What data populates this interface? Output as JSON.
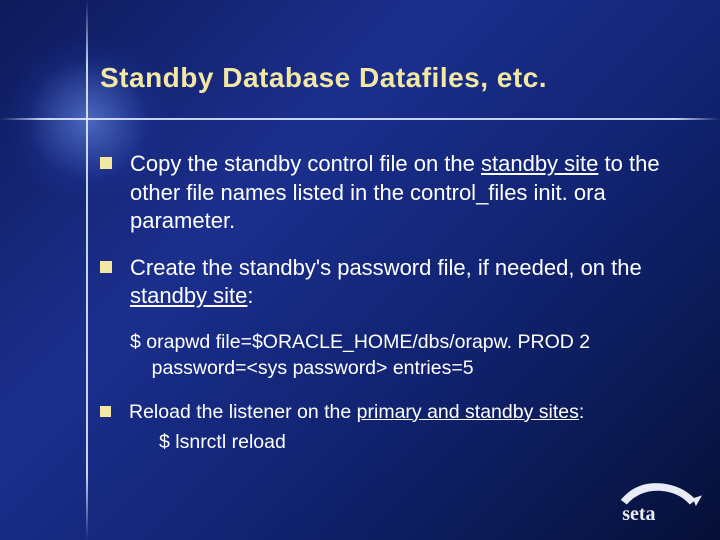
{
  "title": "Standby Database Datafiles, etc.",
  "bullets": {
    "b1": {
      "t1": "Copy the standby control file on the ",
      "u1": "standby site",
      "t2": " to the other file names listed in the control_files init. ora parameter."
    },
    "b2": {
      "t1": "Create the standby's password file, if needed, on the ",
      "u1": "standby site",
      "t2": ":"
    },
    "sub_cmd": {
      "l1": "$ orapwd file=$ORACLE_HOME/dbs/orapw. PROD 2",
      "l2": "password=<sys password> entries=5"
    },
    "b3": {
      "t1": "Reload the listener on the ",
      "u1": "primary and standby sites",
      "t2": ":"
    },
    "sub_cmd2": {
      "l1": "$ lsnrctl reload"
    }
  },
  "logo_text": "seta"
}
